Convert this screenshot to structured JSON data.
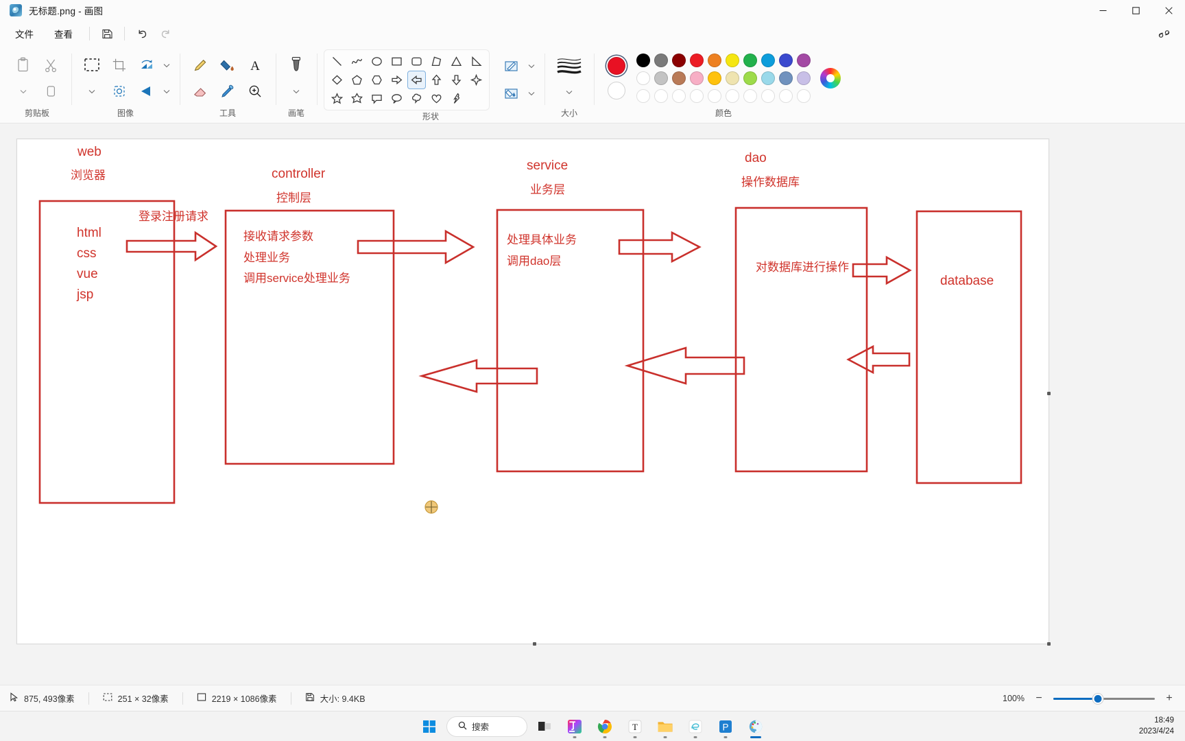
{
  "window": {
    "title": "无标题.png - 画图",
    "app_icon": "paint-app-icon",
    "minimize": "—",
    "maximize": "□",
    "close": "✕"
  },
  "menu": {
    "items": [
      {
        "label": "文件",
        "name": "menu-file"
      },
      {
        "label": "查看",
        "name": "menu-view"
      }
    ],
    "icons": [
      {
        "name": "save-icon"
      },
      {
        "name": "undo-icon"
      },
      {
        "name": "redo-icon"
      }
    ],
    "right_icon": "copilot-icon"
  },
  "ribbon": {
    "groups": [
      {
        "label": "剪贴板",
        "name": "group-clipboard",
        "tools": [
          "paste-icon",
          "cut-icon",
          "copy-icon"
        ]
      },
      {
        "label": "图像",
        "name": "group-image",
        "tools": [
          "select-icon",
          "crop-icon",
          "rotate-icon",
          "resize-icon",
          "flip-icon"
        ]
      },
      {
        "label": "工具",
        "name": "group-tools",
        "tools": [
          "pencil-icon",
          "fill-icon",
          "text-icon",
          "eraser-icon",
          "eyedropper-icon",
          "magnifier-icon"
        ]
      },
      {
        "label": "画笔",
        "name": "group-brushes",
        "tools": [
          "brush-icon"
        ]
      },
      {
        "label": "形状",
        "name": "group-shapes",
        "shapes": [
          [
            "line",
            "curve",
            "oval",
            "rectangle",
            "rounded-rectangle",
            "polygon",
            "triangle",
            "right-triangle"
          ],
          [
            "diamond",
            "pentagon",
            "hexagon",
            "arrow-right",
            "arrow-left",
            "arrow-up",
            "arrow-down",
            "four-point-star"
          ],
          [
            "five-point-star",
            "six-point-star",
            "rounded-callout",
            "oval-callout",
            "cloud-callout",
            "heart",
            "lightning"
          ]
        ],
        "selected_shape": "arrow-left",
        "side_tools": [
          "outline-icon",
          "fill-style-icon"
        ]
      },
      {
        "label": "大小",
        "name": "group-size",
        "tools": [
          "line-thickness-icon"
        ]
      },
      {
        "label": "颜色",
        "name": "group-colors",
        "primary": "#e81123",
        "secondary": "#ffffff",
        "row1": [
          "#000000",
          "#7a7a7a",
          "#8b0000",
          "#ec1c24",
          "#ed8021",
          "#f5e611",
          "#22b14c",
          "#0d9ddb",
          "#3a49ce",
          "#a349a4"
        ],
        "row2": [
          "#ffffff",
          "#c3c3c3",
          "#b97a57",
          "#f7aec5",
          "#ffc20e",
          "#efe4b0",
          "#9ddb4a",
          "#99d9ea",
          "#7092be",
          "#c8bfe7"
        ],
        "row3_empty_count": 10,
        "wheel": "color-wheel-icon"
      }
    ]
  },
  "canvas": {
    "handles": [
      "handle-right",
      "handle-bottom",
      "handle-corner"
    ],
    "cursor": "shape-draw-crosshair-cursor"
  },
  "diagram": {
    "title_labels": [
      {
        "name": "label-web",
        "line1": "web",
        "line2": "浏览器"
      },
      {
        "name": "label-controller",
        "line1": "controller",
        "line2": "控制层"
      },
      {
        "name": "label-service",
        "line1": "service",
        "line2": "业务层"
      },
      {
        "name": "label-dao",
        "line1": "dao",
        "line2": "操作数据库"
      }
    ],
    "web_items": [
      "html",
      "css",
      "vue",
      "jsp"
    ],
    "controller_items": [
      "接收请求参数",
      "处理业务",
      "调用service处理业务"
    ],
    "service_items": [
      "处理具体业务",
      "调用dao层"
    ],
    "dao_items": [
      "对数据库进行操作"
    ],
    "database_label": "database",
    "arrow_labels": [
      {
        "name": "arrow-label-request",
        "text": "登录注册请求"
      }
    ],
    "stroke_color": "#c9302c"
  },
  "statusbar": {
    "cursor_position": "875, 493像素",
    "selection_size": "251 × 32像素",
    "image_size": "2219 × 1086像素",
    "file_size": "大小: 9.4KB",
    "zoom_percent": "100%",
    "zoom_out": "−",
    "zoom_in": "+",
    "icons": {
      "cursor": "cursor-pointer-icon",
      "selection": "selection-icon",
      "image": "image-size-icon",
      "file": "save-disk-icon"
    }
  },
  "taskbar": {
    "start": "windows-start-icon",
    "search_label": "搜索",
    "search_icon": "search-icon",
    "items": [
      {
        "name": "taskview-icon"
      },
      {
        "name": "intellij-idea-icon"
      },
      {
        "name": "google-chrome-icon"
      },
      {
        "name": "typora-icon"
      },
      {
        "name": "file-explorer-icon"
      },
      {
        "name": "edge-icon"
      },
      {
        "name": "powerpoint-icon"
      },
      {
        "name": "paint-icon"
      }
    ],
    "time": "18:49",
    "date": "2023/4/24"
  }
}
